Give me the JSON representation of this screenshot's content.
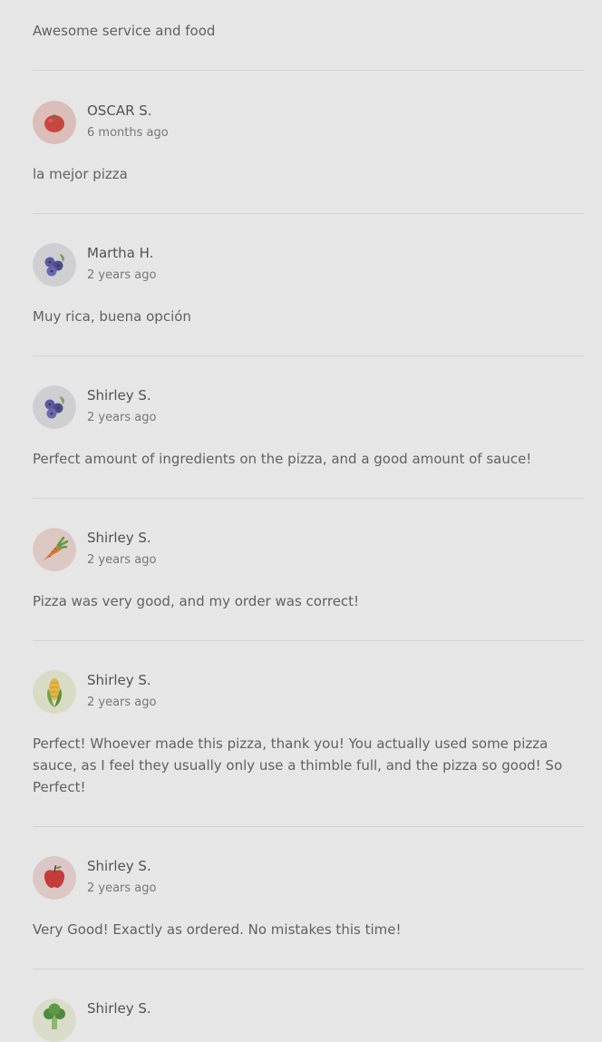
{
  "reviews": {
    "first_text": "Awesome service and food",
    "items": [
      {
        "name": "OSCAR S.",
        "time": "6 months ago",
        "text": "la mejor pizza",
        "avatar": "tomato-icon"
      },
      {
        "name": "Martha H.",
        "time": "2 years ago",
        "text": "Muy rica, buena opción",
        "avatar": "blueberry-icon"
      },
      {
        "name": "Shirley S.",
        "time": "2 years ago",
        "text": "Perfect amount of ingredients on the pizza, and a good amount of sauce!",
        "avatar": "blueberry-icon"
      },
      {
        "name": "Shirley S.",
        "time": "2 years ago",
        "text": "Pizza was very good, and my order was correct!",
        "avatar": "carrot-icon"
      },
      {
        "name": "Shirley S.",
        "time": "2 years ago",
        "text": "Perfect! Whoever made this pizza, thank you! You actually used some pizza sauce, as I feel they usually only use a thimble full, and the pizza so good! So Perfect!",
        "avatar": "corn-icon"
      },
      {
        "name": "Shirley S.",
        "time": "2 years ago",
        "text": "Very Good! Exactly as ordered. No mistakes this time!",
        "avatar": "apple-icon"
      },
      {
        "name": "Shirley S.",
        "time": "",
        "text": "",
        "avatar": "broccoli-icon"
      }
    ]
  }
}
